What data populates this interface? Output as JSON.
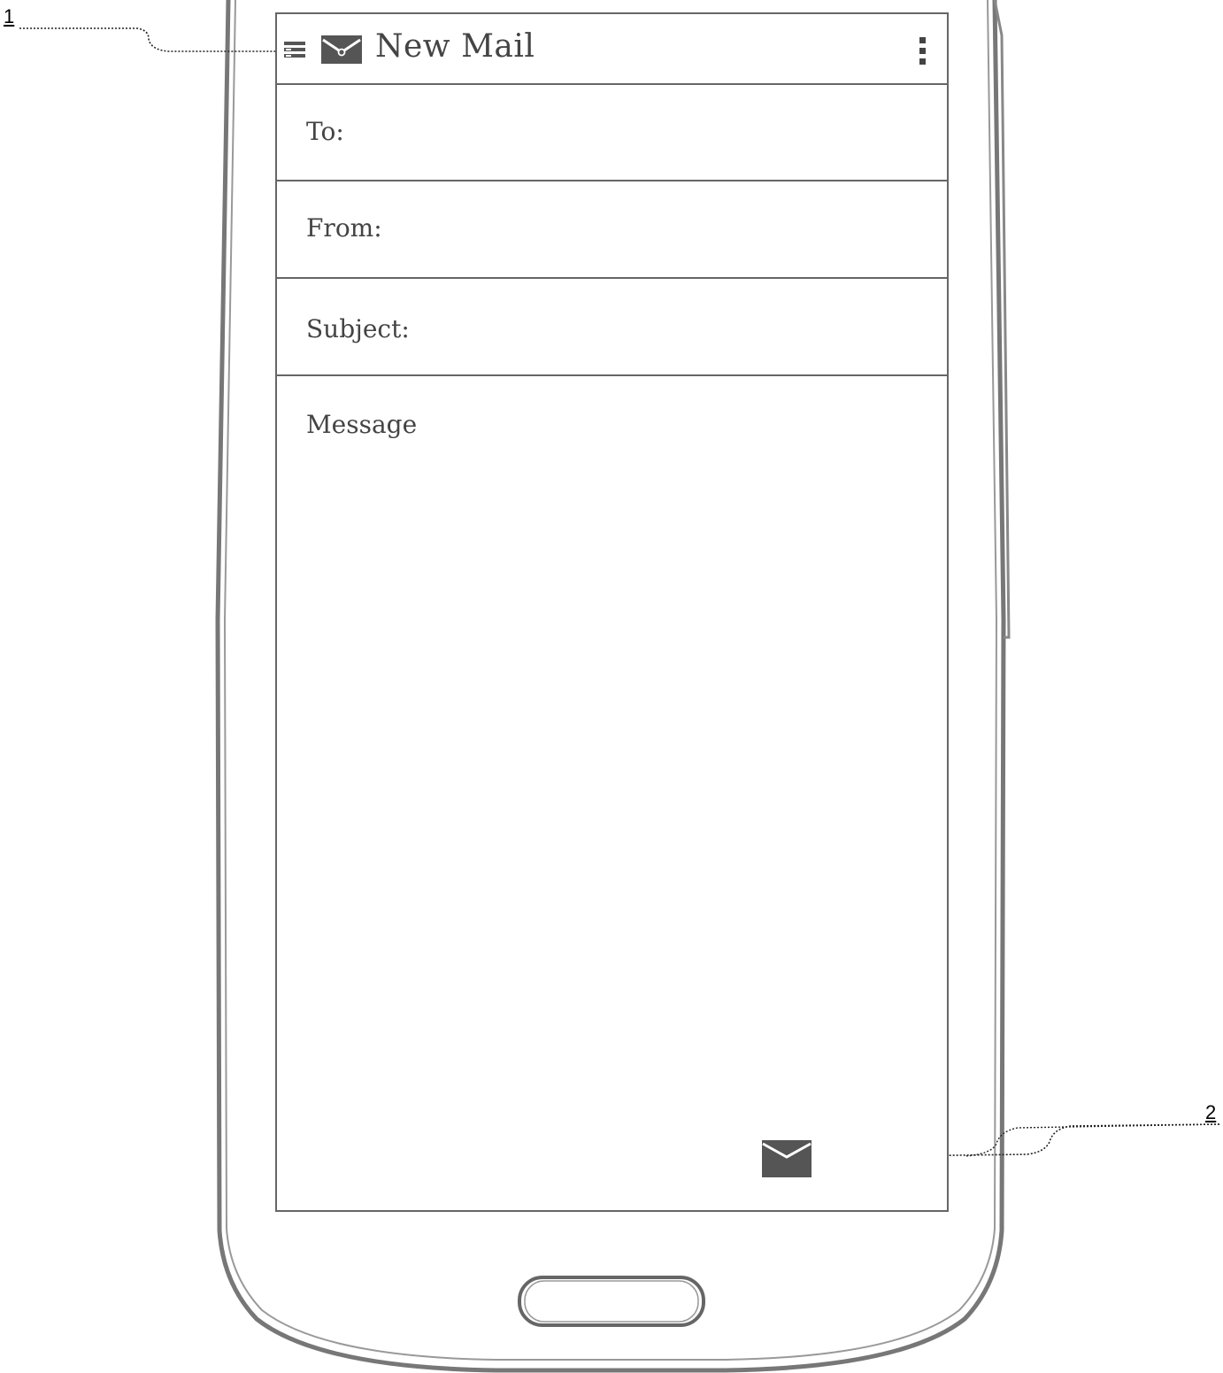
{
  "appbar": {
    "title": "New Mail",
    "menu_icon": "hamburger-menu-icon",
    "app_icon": "envelope-icon",
    "overflow_icon": "more-vertical-icon"
  },
  "form": {
    "to_label": "To:",
    "from_label": "From:",
    "subject_label": "Subject:",
    "message_placeholder": "Message",
    "to_value": "",
    "from_value": "",
    "subject_value": ""
  },
  "send_button": {
    "icon": "send-mail-icon"
  },
  "callouts": {
    "one": "1",
    "two": "2"
  },
  "colors": {
    "outline": "#666666",
    "icon": "#555555",
    "text": "#444444"
  }
}
